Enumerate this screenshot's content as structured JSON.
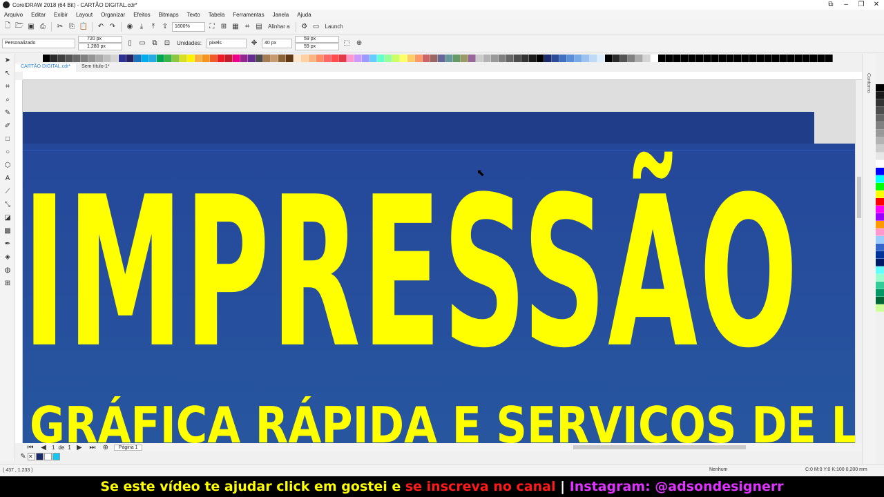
{
  "window": {
    "title": "CorelDRAW 2018 (64 Bit) - CARTÃO DIGITAL.cdr*"
  },
  "menu": [
    "Arquivo",
    "Editar",
    "Exibir",
    "Layout",
    "Organizar",
    "Efeitos",
    "Bitmaps",
    "Texto",
    "Tabela",
    "Ferramentas",
    "Janela",
    "Ajuda"
  ],
  "toolbar": {
    "zoom": "1600%",
    "align_label": "Alinhar a",
    "launch_label": "Launch"
  },
  "propbar": {
    "preset": "Personalizado",
    "width": "720 px",
    "height": "1.280 px",
    "units_label": "Unidades:",
    "units_value": "pixels",
    "nudge": "40 px",
    "dup_x": "59 px",
    "dup_y": "59 px"
  },
  "tabs": [
    "CARTÃO DIGITAL.cdr*",
    "Sem título-1*"
  ],
  "artwork": {
    "headline": "IMPRESSÃO",
    "subline": "GRÁFICA RÁPIDA E SERVIÇOS DE LAN HOUSE"
  },
  "page_nav": {
    "current": "1",
    "of_label": "de",
    "total": "1",
    "page_tab": "Página 1"
  },
  "status": {
    "coords": "( 437 , 1.233 )",
    "fill": "Nenhum",
    "outline": "C:0 M:0 Y:0 K:100  0,200 mm"
  },
  "docker": {
    "label": "Contorno"
  },
  "banner": {
    "part1": "Se este vídeo te ajudar click em gostei e ",
    "part2": "se inscreva no canal ",
    "part3": "| ",
    "part4": "Instagram: @adsondesignerr"
  },
  "colors": {
    "artwork_bg": "#25479a",
    "headline": "#ffff00",
    "accent": "#2b7fd8"
  },
  "icons": [
    "new-icon",
    "open-icon",
    "save-icon",
    "print-icon",
    "undo-icon",
    "redo-icon",
    "import-icon",
    "export-icon",
    "gear-icon",
    "pick-tool-icon",
    "zoom-tool-icon",
    "text-tool-icon"
  ]
}
